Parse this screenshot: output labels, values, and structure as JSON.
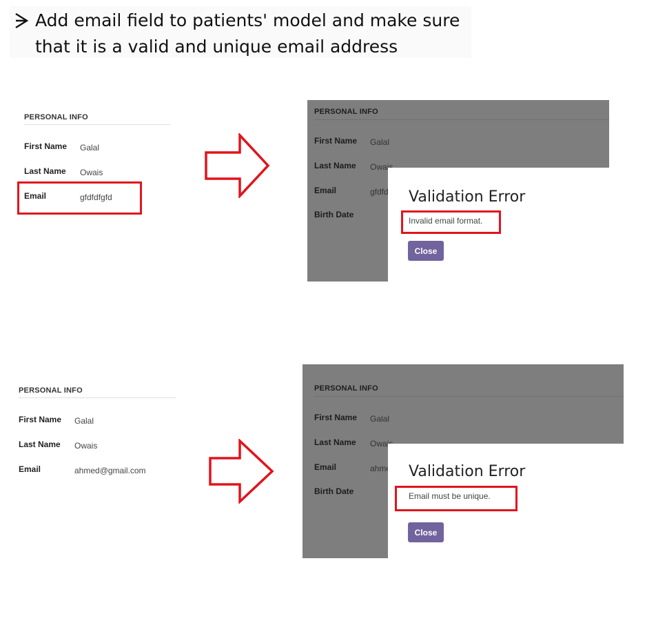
{
  "heading": {
    "line1": "Add email field to patients' model and make sure",
    "line2": "that it is a valid and unique email address"
  },
  "examples": [
    {
      "form": {
        "title": "PERSONAL INFO",
        "fields": [
          {
            "label": "First Name",
            "value": "Galal"
          },
          {
            "label": "Last Name",
            "value": "Owais"
          },
          {
            "label": "Email",
            "value": "gfdfdfgfd"
          }
        ]
      },
      "result": {
        "title": "PERSONAL INFO",
        "fields": [
          {
            "label": "First Name",
            "value": "Galal"
          },
          {
            "label": "Last Name",
            "value": "Owais"
          },
          {
            "label": "Email",
            "value": "gfdfdfgfd"
          },
          {
            "label": "Birth Date",
            "value": ""
          }
        ],
        "dialog": {
          "title": "Validation Error",
          "message": "Invalid email format.",
          "close_label": "Close"
        }
      }
    },
    {
      "form": {
        "title": "PERSONAL INFO",
        "fields": [
          {
            "label": "First Name",
            "value": "Galal"
          },
          {
            "label": "Last Name",
            "value": "Owais"
          },
          {
            "label": "Email",
            "value": "ahmed@gmail.com"
          }
        ]
      },
      "result": {
        "title": "PERSONAL INFO",
        "fields": [
          {
            "label": "First Name",
            "value": "Galal"
          },
          {
            "label": "Last Name",
            "value": "Owais"
          },
          {
            "label": "Email",
            "value": "ahmed@gmail.com"
          },
          {
            "label": "Birth Date",
            "value": ""
          }
        ],
        "dialog": {
          "title": "Validation Error",
          "message": "Email must be unique.",
          "close_label": "Close"
        }
      }
    }
  ],
  "colors": {
    "highlight": "#e0141c",
    "dim_overlay": "#7e7e7e",
    "primary_button": "#71639e"
  },
  "icons": [
    "arrow-bullet-icon",
    "right-arrow-icon"
  ]
}
